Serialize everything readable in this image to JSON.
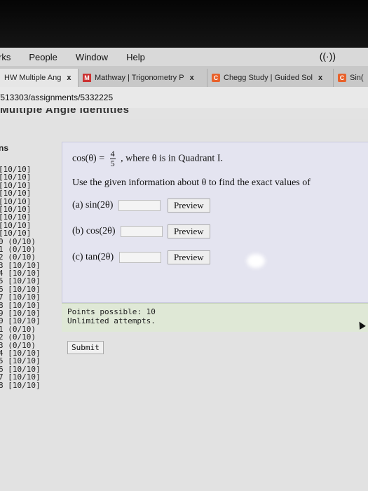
{
  "menubar": {
    "items": [
      "rks",
      "People",
      "Window",
      "Help"
    ]
  },
  "tabs": [
    {
      "label": "HW Multiple Ang",
      "close": "x",
      "favicon": ""
    },
    {
      "label": "Mathway | Trigonometry P",
      "close": "x",
      "favicon": "M"
    },
    {
      "label": "Chegg Study | Guided Sol",
      "close": "x",
      "favicon": "C"
    },
    {
      "label": "Sin(",
      "close": "",
      "favicon": "C"
    }
  ],
  "url": "/513303/assignments/5332225",
  "page_header": "Multiple Angle Identities",
  "sidebar": {
    "header": "ns",
    "scores": [
      "[10/10]",
      "[10/10]",
      "[10/10]",
      "[10/10]",
      "[10/10]",
      "[10/10]",
      "[10/10]",
      "[10/10]",
      "[10/10]",
      "(0/10)",
      "(0/10)",
      "(0/10)",
      "[10/10]",
      "[10/10]",
      "[10/10]",
      "[10/10]",
      "[10/10]",
      "[10/10]",
      "[10/10]",
      "[10/10]",
      "(0/10)",
      "(0/10)",
      "(0/10)",
      "[10/10]",
      "[10/10]",
      "[10/10]",
      "[10/10]",
      "[10/10]"
    ],
    "prefixes": [
      "",
      "",
      "",
      "",
      "",
      "",
      "",
      "",
      "",
      "0",
      "1",
      "2",
      "3",
      "4",
      "5",
      "6",
      "7",
      "8",
      "9",
      "0",
      "1",
      "2",
      "3",
      "4",
      "5",
      "6",
      "7",
      "8"
    ]
  },
  "question": {
    "fn": "cos(θ) =",
    "num": "4",
    "den": "5",
    "condition": ", where θ is in Quadrant I.",
    "instruction": "Use the given information about θ to find the exact values of",
    "parts": [
      {
        "label": "(a) sin(2θ)",
        "button": "Preview"
      },
      {
        "label": "(b) cos(2θ)",
        "button": "Preview"
      },
      {
        "label": "(c) tan(2θ)",
        "button": "Preview"
      }
    ]
  },
  "info": {
    "points": "Points possible: 10",
    "attempts": "Unlimited attempts."
  },
  "submit_label": "Submit"
}
